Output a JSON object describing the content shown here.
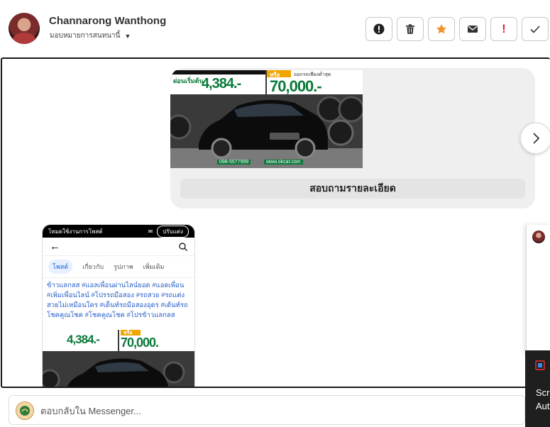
{
  "header": {
    "user_name": "Channarong Wanthong",
    "assign_label": "มอบหมายการสนทนานี้"
  },
  "actions": [
    {
      "icon": "alert-circle-icon",
      "label": "Mark as spam"
    },
    {
      "icon": "trash-icon",
      "label": "Delete"
    },
    {
      "icon": "star-icon",
      "label": "Star",
      "color": "#f0922b"
    },
    {
      "icon": "envelope-icon",
      "label": "Mark unread"
    },
    {
      "icon": "exclamation-icon",
      "label": "!",
      "color": "#e0262b"
    },
    {
      "icon": "check-icon",
      "label": "Done"
    }
  ],
  "carousel": {
    "banner_left_top": "ผ่อนเริ่มต้น",
    "banner_left_amount": "4,384.-",
    "banner_right_tag": "หรือ",
    "banner_right_top": "ออกรถเพียงต่ำสุด",
    "banner_right_amount": "70,000.-",
    "phone_line": "098-5577999",
    "website": "www.okcar.com",
    "cta_label": "สอบถามรายละเอียด"
  },
  "phone_post": {
    "status_left": "โหมดใช้งานการโพสต์",
    "status_pill": "ปรับแต่ง",
    "tabs": [
      "โพสต์",
      "เกี่ยวกับ",
      "รูปภาพ",
      "เพิ่มเติม"
    ],
    "hashtags": "ข้าวแลกลส #แอลเพื่อนผ่านไลน์ยอด #แอดเพื่อน #เพิ่มเพื่อนไลน์ #โปรรถมือสอง #รถสวย #รถแต่งสวยไม่เหมือนใคร #เด็นท์รถมือสองอุดร #เด้นท์รถโชคคูณโชค #โชคคูณโชค #โปรข้าวแลกลส",
    "banner_amount_left": "4,384.-",
    "banner_tag": "หรือ",
    "banner_amount_right": "70,000."
  },
  "side_panel": {
    "line1": "Scr",
    "line2": "Aut"
  },
  "reply": {
    "placeholder": "ตอบกลับใน Messenger..."
  },
  "colors": {
    "star": "#f0922b",
    "alert_red": "#e0262b",
    "hashtag_blue": "#2860c8"
  }
}
